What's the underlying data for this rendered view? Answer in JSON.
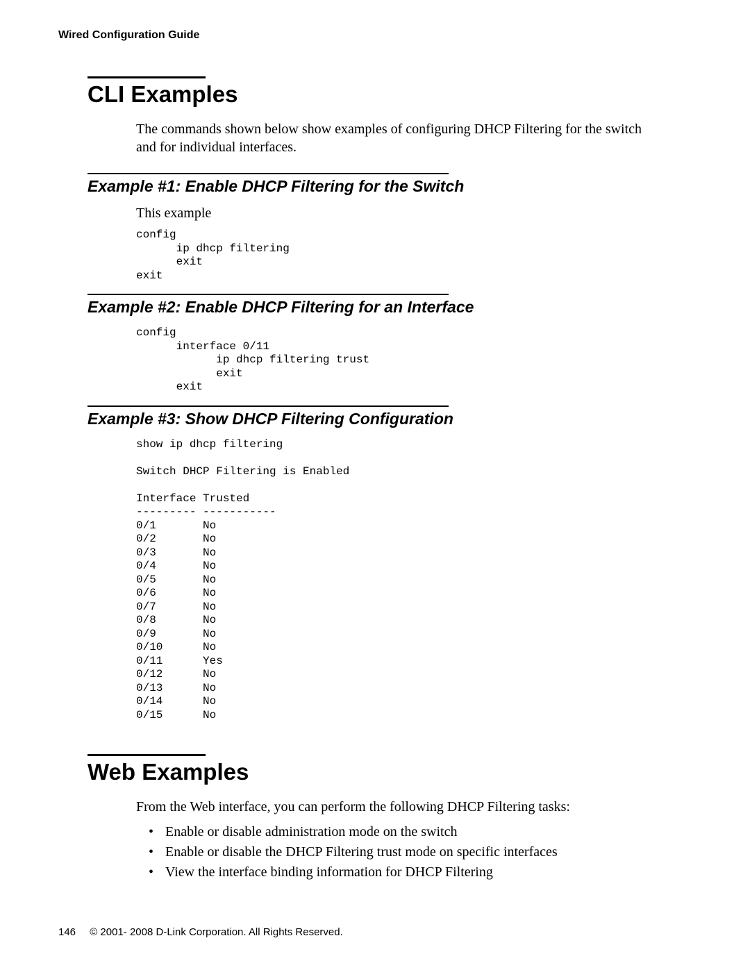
{
  "header": {
    "running_title": "Wired Configuration Guide"
  },
  "section1": {
    "title": "CLI Examples",
    "intro": "The commands shown below show examples of configuring DHCP Filtering for the switch and for individual interfaces."
  },
  "example1": {
    "title": "Example #1: Enable DHCP Filtering for the Switch",
    "intro": "This example",
    "code": "config\n      ip dhcp filtering\n      exit\nexit"
  },
  "example2": {
    "title": "Example #2: Enable DHCP Filtering for an Interface",
    "code": "config\n      interface 0/11\n            ip dhcp filtering trust\n            exit\n      exit"
  },
  "example3": {
    "title": "Example #3: Show DHCP Filtering Configuration",
    "code": "show ip dhcp filtering\n\nSwitch DHCP Filtering is Enabled\n\nInterface Trusted\n--------- -----------\n0/1       No\n0/2       No\n0/3       No\n0/4       No\n0/5       No\n0/6       No\n0/7       No\n0/8       No\n0/9       No\n0/10      No\n0/11      Yes\n0/12      No\n0/13      No\n0/14      No\n0/15      No"
  },
  "section2": {
    "title": "Web Examples",
    "intro": "From the Web interface, you can perform the following DHCP Filtering tasks:",
    "bullets": [
      "Enable or disable administration mode on the switch",
      "Enable or disable the DHCP Filtering trust mode on specific interfaces",
      "View the interface binding information for DHCP Filtering"
    ]
  },
  "footer": {
    "page_number": "146",
    "copyright": "© 2001- 2008 D-Link Corporation. All Rights Reserved."
  }
}
